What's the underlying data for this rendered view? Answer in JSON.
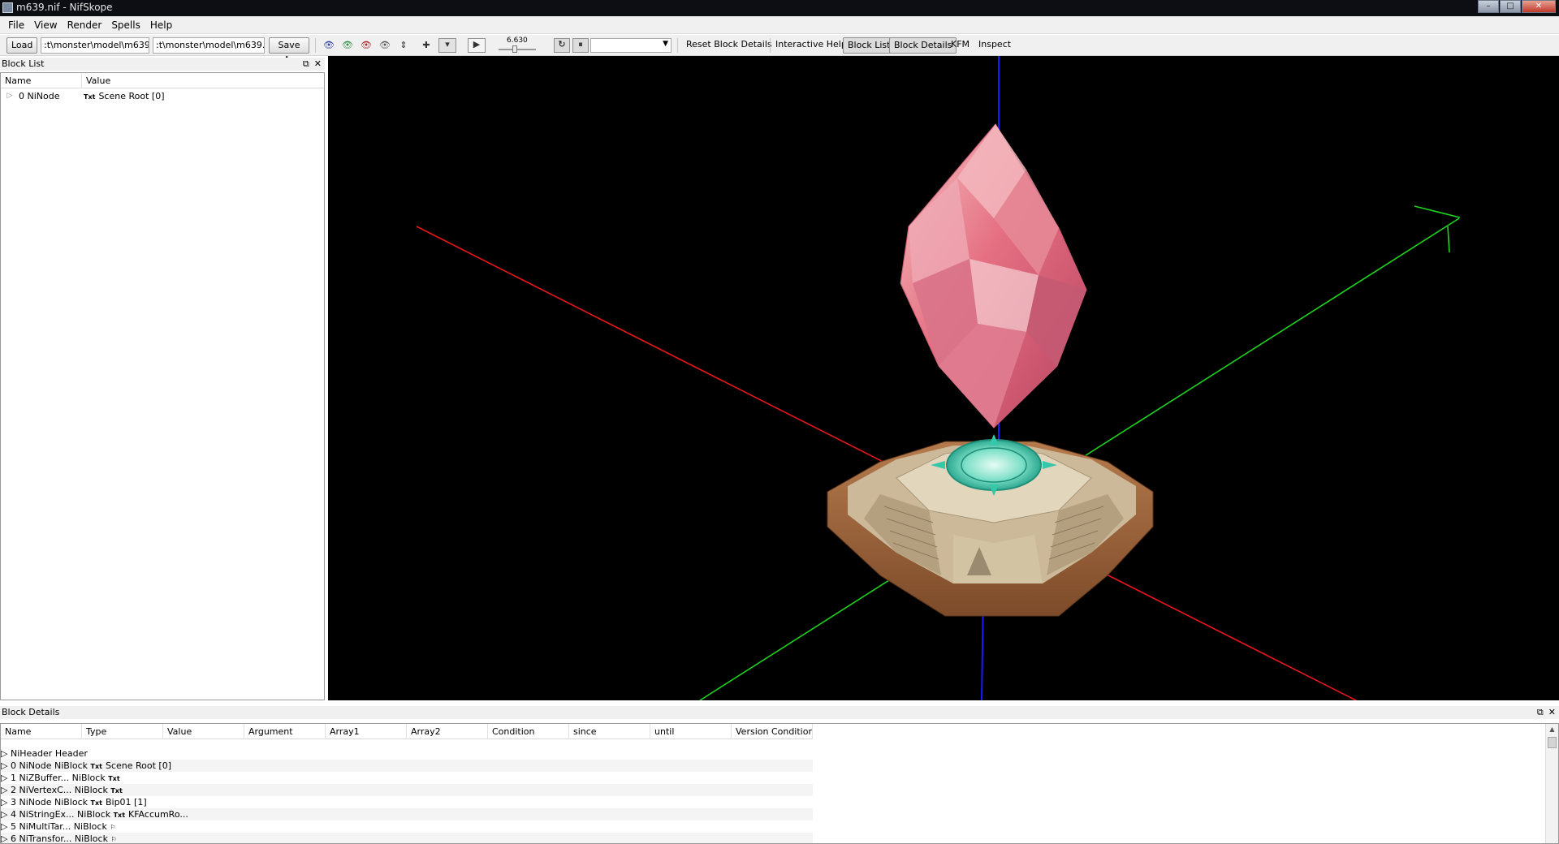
{
  "window": {
    "title": "m639.nif - NifSkope",
    "minimize": "–",
    "maximize": "□",
    "close": "✕"
  },
  "menu": [
    "File",
    "View",
    "Render",
    "Spells",
    "Help"
  ],
  "toolbar": {
    "load_label": "Load",
    "load_path": ":t\\monster\\model\\m639.nif",
    "save_path": ":t\\monster\\model\\m639.nif",
    "save_label": "Save As",
    "time_value": "6.630",
    "reset_label": "Reset Block Details",
    "help_label": "Interactive Help",
    "blocklist_label": "Block List",
    "blockdetails_label": "Block Details",
    "kfm_label": "KFM",
    "inspect_label": "Inspect"
  },
  "block_list": {
    "title": "Block List",
    "columns": [
      "Name",
      "Value"
    ],
    "rows": [
      {
        "name": "0 NiNode",
        "icon": "Txt",
        "value": "Scene Root [0]"
      }
    ]
  },
  "block_details": {
    "title": "Block Details",
    "columns": [
      "Name",
      "Type",
      "Value",
      "Argument",
      "Array1",
      "Array2",
      "Condition",
      "since",
      "until",
      "Version Conditior"
    ],
    "rows": [
      {
        "name": "NiHeader",
        "type": "Header",
        "icon": "",
        "value": ""
      },
      {
        "name": "0 NiNode",
        "type": "NiBlock",
        "icon": "Txt",
        "value": "Scene Root [0]"
      },
      {
        "name": "1 NiZBuffer...",
        "type": "NiBlock",
        "icon": "Txt",
        "value": ""
      },
      {
        "name": "2 NiVertexC...",
        "type": "NiBlock",
        "icon": "Txt",
        "value": ""
      },
      {
        "name": "3 NiNode",
        "type": "NiBlock",
        "icon": "Txt",
        "value": "Bip01 [1]"
      },
      {
        "name": "4 NiStringEx...",
        "type": "NiBlock",
        "icon": "Txt",
        "value": "KFAccumRo..."
      },
      {
        "name": "5 NiMultiTar...",
        "type": "NiBlock",
        "icon": "flag",
        "value": ""
      },
      {
        "name": "6 NiTransfor...",
        "type": "NiBlock",
        "icon": "flag",
        "value": ""
      }
    ]
  },
  "colors": {
    "x_axis": "#e8171c",
    "y_axis": "#1fd21f",
    "z_axis": "#1a1aff",
    "crystal": "#e56f82",
    "base_wood": "#a0673f",
    "base_stone": "#d8c8a8",
    "emblem": "#35c8a8"
  }
}
